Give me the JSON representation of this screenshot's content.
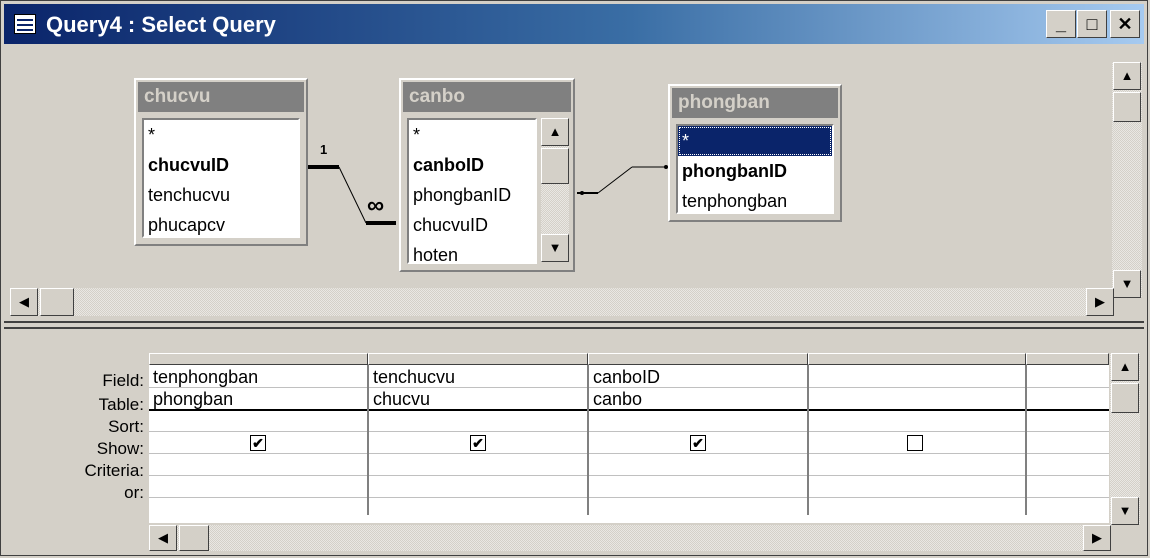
{
  "window": {
    "title": "Query4 : Select Query",
    "controls": {
      "minimize": "_",
      "maximize": "□",
      "close": "✕"
    }
  },
  "tables": [
    {
      "name": "chucvu",
      "fields": [
        {
          "label": "*",
          "bold": false
        },
        {
          "label": "chucvuID",
          "bold": true
        },
        {
          "label": "tenchucvu",
          "bold": false
        },
        {
          "label": "phucapcv",
          "bold": false
        }
      ]
    },
    {
      "name": "canbo",
      "fields": [
        {
          "label": "*",
          "bold": false
        },
        {
          "label": "canboID",
          "bold": true
        },
        {
          "label": "phongbanID",
          "bold": false
        },
        {
          "label": "chucvuID",
          "bold": false
        },
        {
          "label": "hoten",
          "bold": false
        }
      ]
    },
    {
      "name": "phongban",
      "fields": [
        {
          "label": "*",
          "bold": false,
          "selected": true
        },
        {
          "label": "phongbanID",
          "bold": true
        },
        {
          "label": "tenphongban",
          "bold": false
        }
      ]
    }
  ],
  "relationship": {
    "one_label": "1",
    "many_label": "∞"
  },
  "grid": {
    "row_labels": [
      "Field:",
      "Table:",
      "Sort:",
      "Show:",
      "Criteria:",
      "or:"
    ],
    "columns": [
      {
        "field": "tenphongban",
        "table": "phongban",
        "sort": "",
        "show": true,
        "criteria": "",
        "or": ""
      },
      {
        "field": "tenchucvu",
        "table": "chucvu",
        "sort": "",
        "show": true,
        "criteria": "",
        "or": ""
      },
      {
        "field": "canboID",
        "table": "canbo",
        "sort": "",
        "show": true,
        "criteria": "",
        "or": ""
      },
      {
        "field": "",
        "table": "",
        "sort": "",
        "show": false,
        "criteria": "",
        "or": ""
      },
      {
        "field": "",
        "table": "",
        "sort": "",
        "show": null,
        "criteria": "",
        "or": ""
      }
    ]
  },
  "colors": {
    "title_start": "#0a246a",
    "title_end": "#a6caf0",
    "face": "#d4d0c8",
    "selection": "#0a246a"
  }
}
